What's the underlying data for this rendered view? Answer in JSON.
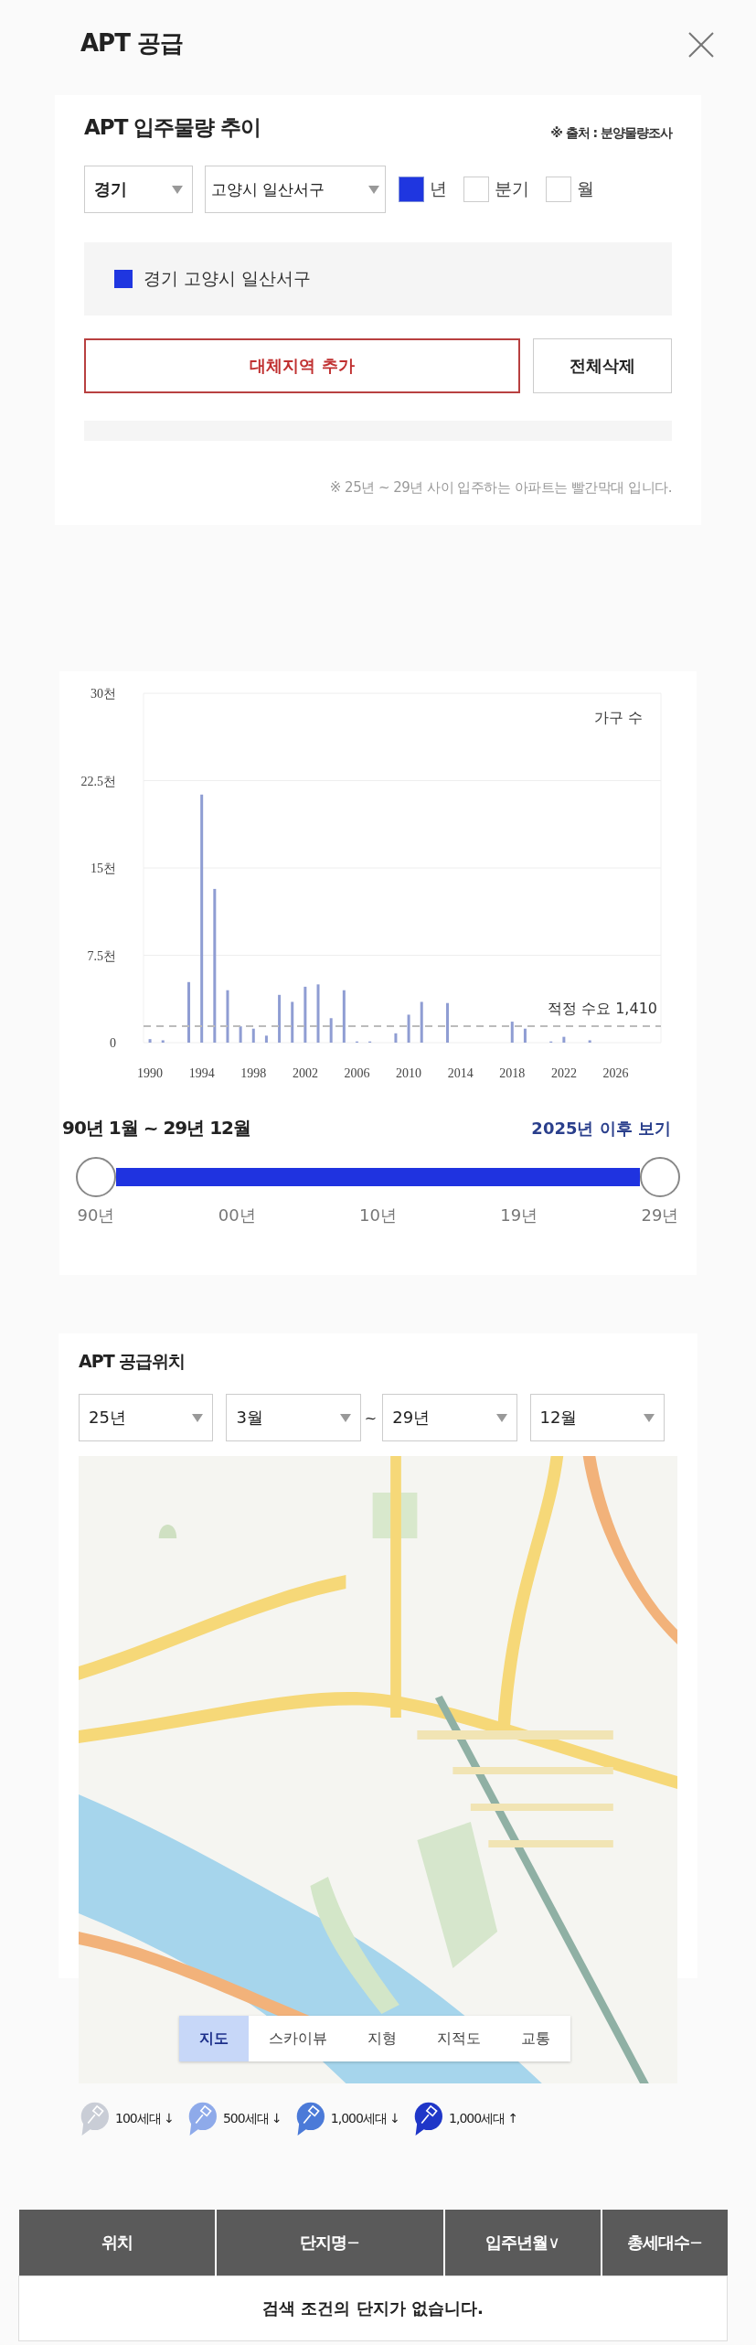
{
  "header": {
    "title": "APT 공급"
  },
  "trend": {
    "title": "APT 입주물량 추이",
    "source": "※ 출처 : 분양물량조사",
    "selects": [
      {
        "value": "경기"
      },
      {
        "value": "고양시 일산서구"
      }
    ],
    "periods": [
      {
        "label": "년",
        "checked": true
      },
      {
        "label": "분기",
        "checked": false
      },
      {
        "label": "월",
        "checked": false
      }
    ],
    "legend": [
      {
        "label": "경기 고양시 일산서구",
        "color": "#1f36e0"
      }
    ],
    "buttons": [
      {
        "label": "대체지역 추가",
        "kind": "accent"
      },
      {
        "label": "전체삭제",
        "kind": "plain"
      }
    ],
    "note": "※ 25년 ~ 29년 사이 입주하는 아파트는 빨간막대 입니다."
  },
  "chart": {
    "chart_data": {
      "type": "bar",
      "ylabel": "가구 수",
      "x": [
        1990,
        1991,
        1993,
        1994,
        1995,
        1996,
        1997,
        1998,
        1999,
        2000,
        2001,
        2002,
        2003,
        2004,
        2005,
        2006,
        2007,
        2009,
        2010,
        2011,
        2013,
        2018,
        2019,
        2021,
        2022,
        2024
      ],
      "series": [
        {
          "color": "#8f9dd3",
          "values": [
            0.3,
            0.2,
            5.2,
            21.3,
            13.2,
            4.5,
            1.4,
            1.2,
            0.6,
            4.1,
            3.5,
            4.8,
            5.0,
            2.1,
            4.5,
            0.1,
            0.1,
            0.8,
            2.4,
            3.5,
            3.4,
            1.8,
            1.2,
            0.1,
            0.5,
            0.2
          ]
        }
      ],
      "xlim": [
        1989.5,
        2029.5
      ],
      "ylim": [
        0,
        30
      ],
      "yticks": [
        0,
        {
          "value": 7.5,
          "label": "7.5천"
        },
        {
          "value": 15,
          "label": "15천"
        },
        {
          "value": 22.5,
          "label": "22.5천"
        },
        {
          "value": 30,
          "label": "30천"
        }
      ],
      "xticks": [
        1990,
        1994,
        1998,
        2002,
        2006,
        2010,
        2014,
        2018,
        2022,
        2026
      ],
      "grid": true,
      "ref_lines": [
        {
          "axis": "y",
          "value": 1.41,
          "label": "적정 수요 1,410"
        }
      ]
    },
    "range_label": "90년 1월 ~ 29년 12월",
    "future_link": "2025년 이후 보기",
    "slider": {
      "ticks": [
        "90년",
        "00년",
        "10년",
        "19년",
        "29년"
      ]
    }
  },
  "location": {
    "title": "APT 공급위치",
    "selects": [
      {
        "value": "25년"
      },
      {
        "value": "3월"
      },
      {
        "value": "29년"
      },
      {
        "value": "12월"
      }
    ],
    "separator": "~",
    "map": {
      "kind": "picture",
      "tabs": [
        {
          "label": "지도",
          "selected": true
        },
        {
          "label": "스카이뷰",
          "selected": false
        },
        {
          "label": "지형",
          "selected": false
        },
        {
          "label": "지적도",
          "selected": false
        },
        {
          "label": "교통",
          "selected": false
        }
      ]
    },
    "legend": [
      {
        "label": "100세대 ↓",
        "color": "#c9cdd6"
      },
      {
        "label": "500세대 ↓",
        "color": "#8eaaea"
      },
      {
        "label": "1,000세대 ↓",
        "color": "#4b7ad8"
      },
      {
        "label": "1,000세대 ↑",
        "color": "#1f36c8"
      }
    ]
  },
  "table": {
    "columns": [
      {
        "label": "위치"
      },
      {
        "label": "단지명",
        "sort": "−"
      },
      {
        "label": "입주년월",
        "sort": "∨"
      },
      {
        "label": "총세대수",
        "sort": "−"
      }
    ],
    "empty": "검색 조건의 단지가 없습니다."
  }
}
